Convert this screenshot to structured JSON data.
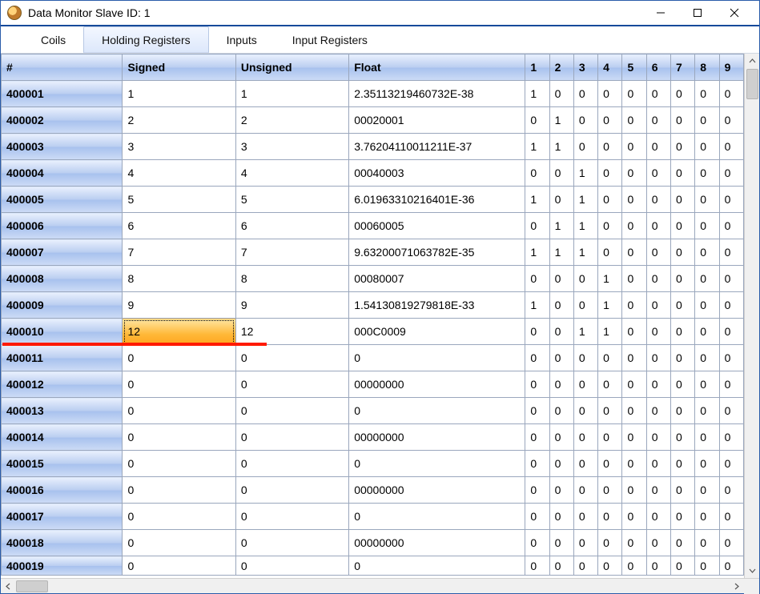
{
  "window": {
    "title": "Data Monitor Slave ID: 1"
  },
  "tabs": {
    "coils": "Coils",
    "holding": "Holding Registers",
    "inputs": "Inputs",
    "inputregs": "Input Registers",
    "active": "holding"
  },
  "columns": {
    "index": "#",
    "signed": "Signed",
    "unsigned": "Unsigned",
    "float": "Float",
    "bits": [
      "1",
      "2",
      "3",
      "4",
      "5",
      "6",
      "7",
      "8",
      "9"
    ]
  },
  "editing_cell": {
    "row_index": 9,
    "column": "signed"
  },
  "rows": [
    {
      "idx": "400001",
      "signed": "1",
      "unsigned": "1",
      "float": "2.35113219460732E-38",
      "bits": [
        "1",
        "0",
        "0",
        "0",
        "0",
        "0",
        "0",
        "0",
        "0"
      ]
    },
    {
      "idx": "400002",
      "signed": "2",
      "unsigned": "2",
      "float": "00020001",
      "bits": [
        "0",
        "1",
        "0",
        "0",
        "0",
        "0",
        "0",
        "0",
        "0"
      ]
    },
    {
      "idx": "400003",
      "signed": "3",
      "unsigned": "3",
      "float": "3.76204110011211E-37",
      "bits": [
        "1",
        "1",
        "0",
        "0",
        "0",
        "0",
        "0",
        "0",
        "0"
      ]
    },
    {
      "idx": "400004",
      "signed": "4",
      "unsigned": "4",
      "float": "00040003",
      "bits": [
        "0",
        "0",
        "1",
        "0",
        "0",
        "0",
        "0",
        "0",
        "0"
      ]
    },
    {
      "idx": "400005",
      "signed": "5",
      "unsigned": "5",
      "float": "6.01963310216401E-36",
      "bits": [
        "1",
        "0",
        "1",
        "0",
        "0",
        "0",
        "0",
        "0",
        "0"
      ]
    },
    {
      "idx": "400006",
      "signed": "6",
      "unsigned": "6",
      "float": "00060005",
      "bits": [
        "0",
        "1",
        "1",
        "0",
        "0",
        "0",
        "0",
        "0",
        "0"
      ]
    },
    {
      "idx": "400007",
      "signed": "7",
      "unsigned": "7",
      "float": "9.63200071063782E-35",
      "bits": [
        "1",
        "1",
        "1",
        "0",
        "0",
        "0",
        "0",
        "0",
        "0"
      ]
    },
    {
      "idx": "400008",
      "signed": "8",
      "unsigned": "8",
      "float": "00080007",
      "bits": [
        "0",
        "0",
        "0",
        "1",
        "0",
        "0",
        "0",
        "0",
        "0"
      ]
    },
    {
      "idx": "400009",
      "signed": "9",
      "unsigned": "9",
      "float": "1.54130819279818E-33",
      "bits": [
        "1",
        "0",
        "0",
        "1",
        "0",
        "0",
        "0",
        "0",
        "0"
      ]
    },
    {
      "idx": "400010",
      "signed": "12",
      "unsigned": "12",
      "float": "000C0009",
      "bits": [
        "0",
        "0",
        "1",
        "1",
        "0",
        "0",
        "0",
        "0",
        "0"
      ]
    },
    {
      "idx": "400011",
      "signed": "0",
      "unsigned": "0",
      "float": "0",
      "bits": [
        "0",
        "0",
        "0",
        "0",
        "0",
        "0",
        "0",
        "0",
        "0"
      ]
    },
    {
      "idx": "400012",
      "signed": "0",
      "unsigned": "0",
      "float": "00000000",
      "bits": [
        "0",
        "0",
        "0",
        "0",
        "0",
        "0",
        "0",
        "0",
        "0"
      ]
    },
    {
      "idx": "400013",
      "signed": "0",
      "unsigned": "0",
      "float": "0",
      "bits": [
        "0",
        "0",
        "0",
        "0",
        "0",
        "0",
        "0",
        "0",
        "0"
      ]
    },
    {
      "idx": "400014",
      "signed": "0",
      "unsigned": "0",
      "float": "00000000",
      "bits": [
        "0",
        "0",
        "0",
        "0",
        "0",
        "0",
        "0",
        "0",
        "0"
      ]
    },
    {
      "idx": "400015",
      "signed": "0",
      "unsigned": "0",
      "float": "0",
      "bits": [
        "0",
        "0",
        "0",
        "0",
        "0",
        "0",
        "0",
        "0",
        "0"
      ]
    },
    {
      "idx": "400016",
      "signed": "0",
      "unsigned": "0",
      "float": "00000000",
      "bits": [
        "0",
        "0",
        "0",
        "0",
        "0",
        "0",
        "0",
        "0",
        "0"
      ]
    },
    {
      "idx": "400017",
      "signed": "0",
      "unsigned": "0",
      "float": "0",
      "bits": [
        "0",
        "0",
        "0",
        "0",
        "0",
        "0",
        "0",
        "0",
        "0"
      ]
    },
    {
      "idx": "400018",
      "signed": "0",
      "unsigned": "0",
      "float": "00000000",
      "bits": [
        "0",
        "0",
        "0",
        "0",
        "0",
        "0",
        "0",
        "0",
        "0"
      ]
    },
    {
      "idx": "400019",
      "signed": "0",
      "unsigned": "0",
      "float": "0",
      "bits": [
        "0",
        "0",
        "0",
        "0",
        "0",
        "0",
        "0",
        "0",
        "0"
      ]
    }
  ]
}
